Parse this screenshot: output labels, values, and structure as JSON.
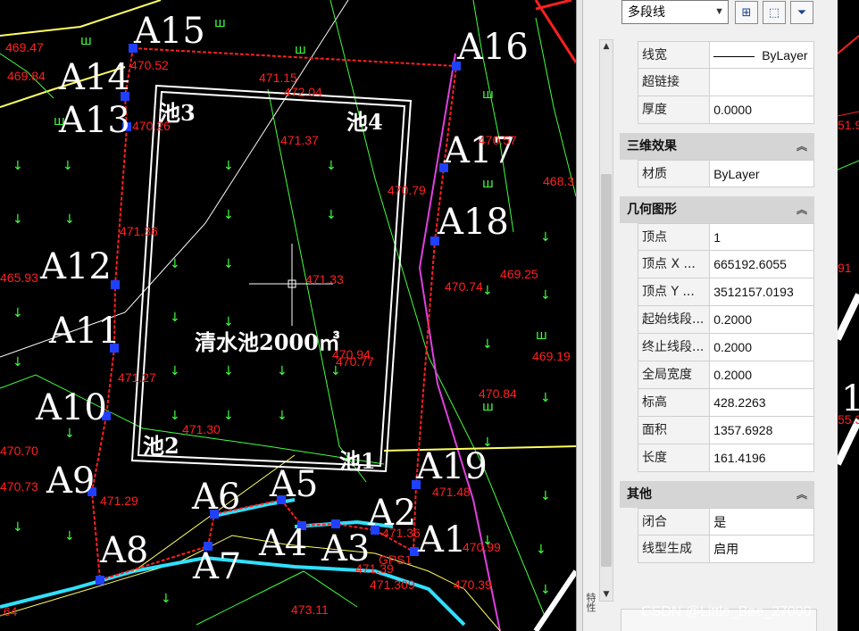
{
  "drawing": {
    "points": [
      {
        "id": "A1",
        "label": "A1"
      },
      {
        "id": "A2",
        "label": "A2"
      },
      {
        "id": "A3",
        "label": "A3"
      },
      {
        "id": "A4",
        "label": "A4"
      },
      {
        "id": "A5",
        "label": "A5"
      },
      {
        "id": "A6",
        "label": "A6"
      },
      {
        "id": "A7",
        "label": "A7"
      },
      {
        "id": "A8",
        "label": "A8"
      },
      {
        "id": "A9",
        "label": "A9"
      },
      {
        "id": "A10",
        "label": "A10"
      },
      {
        "id": "A11",
        "label": "A11"
      },
      {
        "id": "A12",
        "label": "A12"
      },
      {
        "id": "A13",
        "label": "A13"
      },
      {
        "id": "A14",
        "label": "A14"
      },
      {
        "id": "A15",
        "label": "A15"
      },
      {
        "id": "A16",
        "label": "A16"
      },
      {
        "id": "A17",
        "label": "A17"
      },
      {
        "id": "A18",
        "label": "A18"
      },
      {
        "id": "A19",
        "label": "A19"
      }
    ],
    "pool_labels": {
      "c1": "池1",
      "c2": "池2",
      "c3": "池3",
      "c4": "池4"
    },
    "pool_title": "清水池2000㎥",
    "elevations": [
      "469.47",
      "469.84",
      "470.52",
      "471.15",
      "472.04",
      "471.37",
      "470.26",
      "470.79",
      "471.36",
      "471.33",
      "470.74",
      "469.25",
      "465.93",
      "471.27",
      "470.94",
      "470.77",
      "470.84",
      "469.19",
      "471.30",
      "470.73",
      "471.29",
      "470.70",
      "471.48",
      "471.36",
      "470.99",
      "471.39",
      "471.309",
      "470.39",
      "473.11",
      "468.3",
      "470.57",
      ".64",
      "91",
      "55.3",
      "51.9"
    ],
    "gps_label": "GPS1"
  },
  "palette": {
    "object_type": "多段线",
    "toolbar": [
      "quick-select",
      "select-objects",
      "toggle-pickadd"
    ],
    "vertical_tab": "特性",
    "top_rows": [
      {
        "key": "线宽",
        "value": "ByLayer"
      },
      {
        "key": "超链接",
        "value": ""
      },
      {
        "key": "厚度",
        "value": "0.0000"
      }
    ],
    "sections": [
      {
        "title": "三维效果",
        "rows": [
          {
            "key": "材质",
            "value": "ByLayer"
          }
        ]
      },
      {
        "title": "几何图形",
        "rows": [
          {
            "key": "顶点",
            "value": "1"
          },
          {
            "key": "顶点 X ...",
            "value": "665192.6055"
          },
          {
            "key": "顶点 Y ...",
            "value": "3512157.0193"
          },
          {
            "key": "起始线段...",
            "value": "0.2000"
          },
          {
            "key": "终止线段...",
            "value": "0.2000"
          },
          {
            "key": "全局宽度",
            "value": "0.2000"
          },
          {
            "key": "标高",
            "value": "428.2263"
          },
          {
            "key": "面积",
            "value": "1357.6928"
          },
          {
            "key": "长度",
            "value": "161.4196"
          }
        ]
      },
      {
        "title": "其他",
        "rows": [
          {
            "key": "闭合",
            "value": "是"
          },
          {
            "key": "线型生成",
            "value": "启用"
          }
        ]
      }
    ]
  },
  "right_canvas": {
    "label": "1"
  },
  "watermark": "CSDN @Little_Bee_27000"
}
